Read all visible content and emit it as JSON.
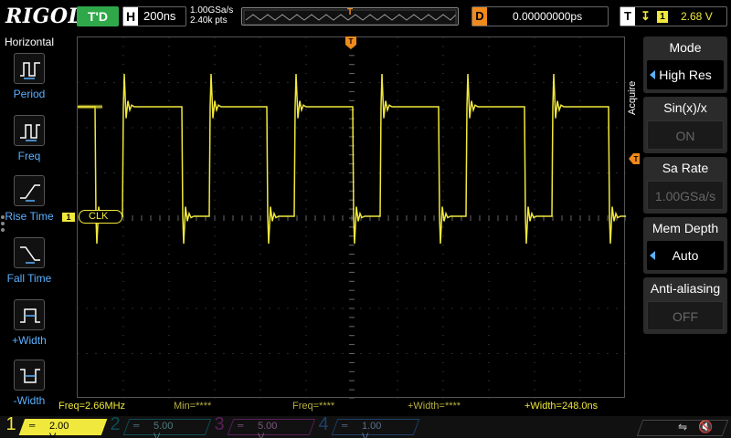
{
  "header": {
    "logo": "RIGOL",
    "run_status": "T'D",
    "horizontal_label": "H",
    "timebase": "200ns",
    "sample_rate": "1.00GSa/s",
    "mem_points": "2.40k pts",
    "delay_label": "D",
    "delay_value": "0.00000000ps",
    "trigger_label": "T",
    "trigger_edge": "↧",
    "trigger_channel": "1",
    "trigger_level": "2.68 V"
  },
  "left_menu": {
    "title": "Horizontal",
    "items": [
      {
        "label": "Period",
        "icon": "period-icon"
      },
      {
        "label": "Freq",
        "icon": "frequency-icon"
      },
      {
        "label": "Rise Time",
        "icon": "rise-time-icon"
      },
      {
        "label": "Fall Time",
        "icon": "fall-time-icon"
      },
      {
        "label": "+Width",
        "icon": "positive-width-icon"
      },
      {
        "label": "-Width",
        "icon": "negative-width-icon"
      }
    ]
  },
  "waveform": {
    "channel_marker": "1",
    "channel_label": "CLK",
    "color": "#f0e83c"
  },
  "right_menu": {
    "side_label": "Acquire",
    "items": [
      {
        "title": "Mode",
        "value": "High Res",
        "active": true
      },
      {
        "title": "Sin(x)/x",
        "value": "ON",
        "active": false
      },
      {
        "title": "Sa Rate",
        "value": "1.00GSa/s",
        "active": false
      },
      {
        "title": "Mem Depth",
        "value": "Auto",
        "active": true
      },
      {
        "title": "Anti-aliasing",
        "value": "OFF",
        "active": false
      }
    ]
  },
  "measurements": {
    "freq": "Freq=2.66MHz",
    "min": "Min=****",
    "freq2": "Freq=****",
    "pwidth": "+Width=****",
    "pwidth2": "+Width=248.0ns"
  },
  "channels": [
    {
      "num": "1",
      "coupling": "═",
      "scale": "2.00 V"
    },
    {
      "num": "2",
      "coupling": "═",
      "scale": "5.00 V"
    },
    {
      "num": "3",
      "coupling": "═",
      "scale": "5.00 V"
    },
    {
      "num": "4",
      "coupling": "═",
      "scale": "1.00 V"
    }
  ],
  "status": {
    "usb": "⇋",
    "speaker": "🔇"
  },
  "colors": {
    "ch1": "#f0e83c",
    "accent_blue": "#5ab0ff",
    "trigger_orange": "#f08a1c",
    "run_green": "#2fa84a"
  }
}
